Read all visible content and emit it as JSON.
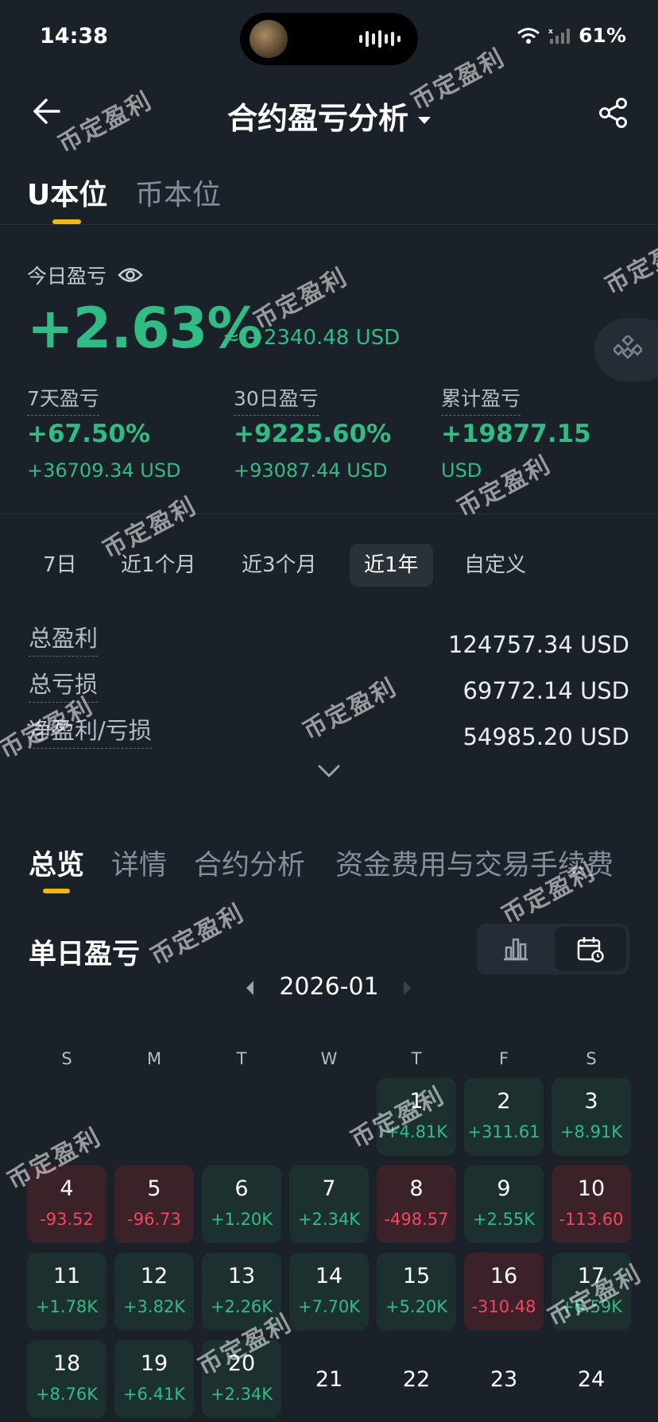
{
  "status": {
    "time": "14:38",
    "battery": "61%"
  },
  "header": {
    "title": "合约盈亏分析"
  },
  "unit_tabs": [
    "U本位",
    "币本位"
  ],
  "today": {
    "label": "今日盈亏",
    "pct": "+2.63%",
    "approx": "≈ +2340.48 USD"
  },
  "stats": [
    {
      "label": "7天盈亏",
      "pct": "+67.50%",
      "usd": "+36709.34 USD"
    },
    {
      "label": "30日盈亏",
      "pct": "+9225.60%",
      "usd": "+93087.44 USD"
    },
    {
      "label": "累计盈亏",
      "pct": "+19877.15",
      "usd": "USD"
    }
  ],
  "periods": [
    "7日",
    "近1个月",
    "近3个月",
    "近1年",
    "自定义"
  ],
  "active_period": "近1年",
  "totals": [
    {
      "label": "总盈利",
      "value": "124757.34 USD"
    },
    {
      "label": "总亏损",
      "value": "69772.14 USD"
    },
    {
      "label": "净盈利/亏损",
      "value": "54985.20 USD"
    }
  ],
  "section_tabs": [
    "总览",
    "详情",
    "合约分析",
    "资金费用与交易手续费"
  ],
  "daily": {
    "title": "单日盈亏",
    "month": "2026-01"
  },
  "weekdays": [
    "S",
    "M",
    "T",
    "W",
    "T",
    "F",
    "S"
  ],
  "calendar": [
    {
      "day": "1",
      "value": "+4.81K",
      "type": "pos"
    },
    {
      "day": "2",
      "value": "+311.61",
      "type": "pos"
    },
    {
      "day": "3",
      "value": "+8.91K",
      "type": "pos"
    },
    {
      "day": "4",
      "value": "-93.52",
      "type": "neg"
    },
    {
      "day": "5",
      "value": "-96.73",
      "type": "neg"
    },
    {
      "day": "6",
      "value": "+1.20K",
      "type": "pos"
    },
    {
      "day": "7",
      "value": "+2.34K",
      "type": "pos"
    },
    {
      "day": "8",
      "value": "-498.57",
      "type": "neg"
    },
    {
      "day": "9",
      "value": "+2.55K",
      "type": "pos"
    },
    {
      "day": "10",
      "value": "-113.60",
      "type": "neg"
    },
    {
      "day": "11",
      "value": "+1.78K",
      "type": "pos"
    },
    {
      "day": "12",
      "value": "+3.82K",
      "type": "pos"
    },
    {
      "day": "13",
      "value": "+2.26K",
      "type": "pos"
    },
    {
      "day": "14",
      "value": "+7.70K",
      "type": "pos"
    },
    {
      "day": "15",
      "value": "+5.20K",
      "type": "pos"
    },
    {
      "day": "16",
      "value": "-310.48",
      "type": "neg"
    },
    {
      "day": "17",
      "value": "+6.59K",
      "type": "pos"
    },
    {
      "day": "18",
      "value": "+8.76K",
      "type": "pos"
    },
    {
      "day": "19",
      "value": "+6.41K",
      "type": "pos"
    },
    {
      "day": "20",
      "value": "+2.34K",
      "type": "pos"
    },
    {
      "day": "21",
      "value": "",
      "type": "empty"
    },
    {
      "day": "22",
      "value": "",
      "type": "empty"
    },
    {
      "day": "23",
      "value": "",
      "type": "empty"
    },
    {
      "day": "24",
      "value": "",
      "type": "empty"
    }
  ],
  "watermark": "币定盈利",
  "colors": {
    "profit": "#2ebd85",
    "loss": "#f6465d",
    "accent": "#f0b90b",
    "background": "#1b2129"
  }
}
